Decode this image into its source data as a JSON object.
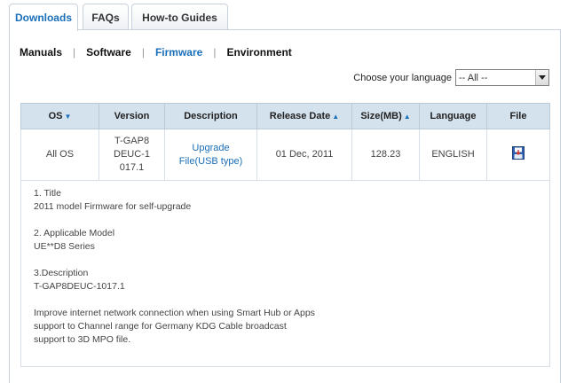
{
  "tabs": [
    {
      "label": "Downloads"
    },
    {
      "label": "FAQs"
    },
    {
      "label": "How-to Guides"
    }
  ],
  "subnav": {
    "items": [
      "Manuals",
      "Software",
      "Firmware",
      "Environment"
    ],
    "separator": "|",
    "current": "Firmware"
  },
  "language": {
    "label": "Choose your language",
    "selected": "-- All --"
  },
  "table": {
    "headers": {
      "os": "OS",
      "version": "Version",
      "description": "Description",
      "release_date": "Release Date",
      "size": "Size(MB)",
      "language": "Language",
      "file": "File"
    },
    "row": {
      "os": "All OS",
      "version": "T-GAP8DEUC-1017.1",
      "description": "Upgrade File(USB type)",
      "release_date": "01 Dec, 2011",
      "size": "128.23",
      "language": "ENGLISH",
      "file_icon": "save-disk-icon"
    }
  },
  "details": {
    "title_heading": "1. Title",
    "title_value": "2011 model Firmware for self-upgrade",
    "model_heading": "2. Applicable Model",
    "model_value": "UE**D8 Series",
    "desc_heading": "3.Description",
    "desc_value": "T-GAP8DEUC-1017.1",
    "notes": [
      "Improve internet network connection when using Smart Hub or Apps",
      "support to Channel range for Germany KDG Cable broadcast",
      "support to 3D MPO file."
    ]
  },
  "colors": {
    "accent": "#1a6fb9",
    "header_bg": "#d4e2ee",
    "border": "#c9d2dc"
  }
}
